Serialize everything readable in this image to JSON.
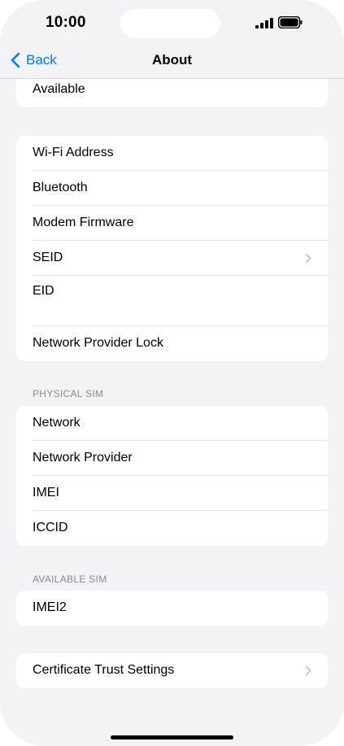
{
  "status_bar": {
    "time": "10:00"
  },
  "nav": {
    "back_label": "Back",
    "title": "About"
  },
  "group0": {
    "rows": [
      {
        "label": "Available"
      }
    ]
  },
  "group1": {
    "rows": [
      {
        "label": "Wi-Fi Address"
      },
      {
        "label": "Bluetooth"
      },
      {
        "label": "Modem Firmware"
      },
      {
        "label": "SEID"
      },
      {
        "label": "EID"
      },
      {
        "label": "Network Provider Lock"
      }
    ]
  },
  "physical_sim": {
    "header": "PHYSICAL SIM",
    "rows": [
      {
        "label": "Network"
      },
      {
        "label": "Network Provider"
      },
      {
        "label": "IMEI"
      },
      {
        "label": "ICCID"
      }
    ]
  },
  "available_sim": {
    "header": "AVAILABLE SIM",
    "rows": [
      {
        "label": "IMEI2"
      }
    ]
  },
  "certificate": {
    "rows": [
      {
        "label": "Certificate Trust Settings"
      }
    ]
  },
  "colors": {
    "accent": "#007aff",
    "background": "#f2f2f7",
    "separator": "#e3e3e8",
    "secondary_text": "#8a8a8e"
  },
  "icons": [
    "back-chevron-icon",
    "chevron-right-icon",
    "cellular-signal-icon",
    "battery-icon"
  ]
}
